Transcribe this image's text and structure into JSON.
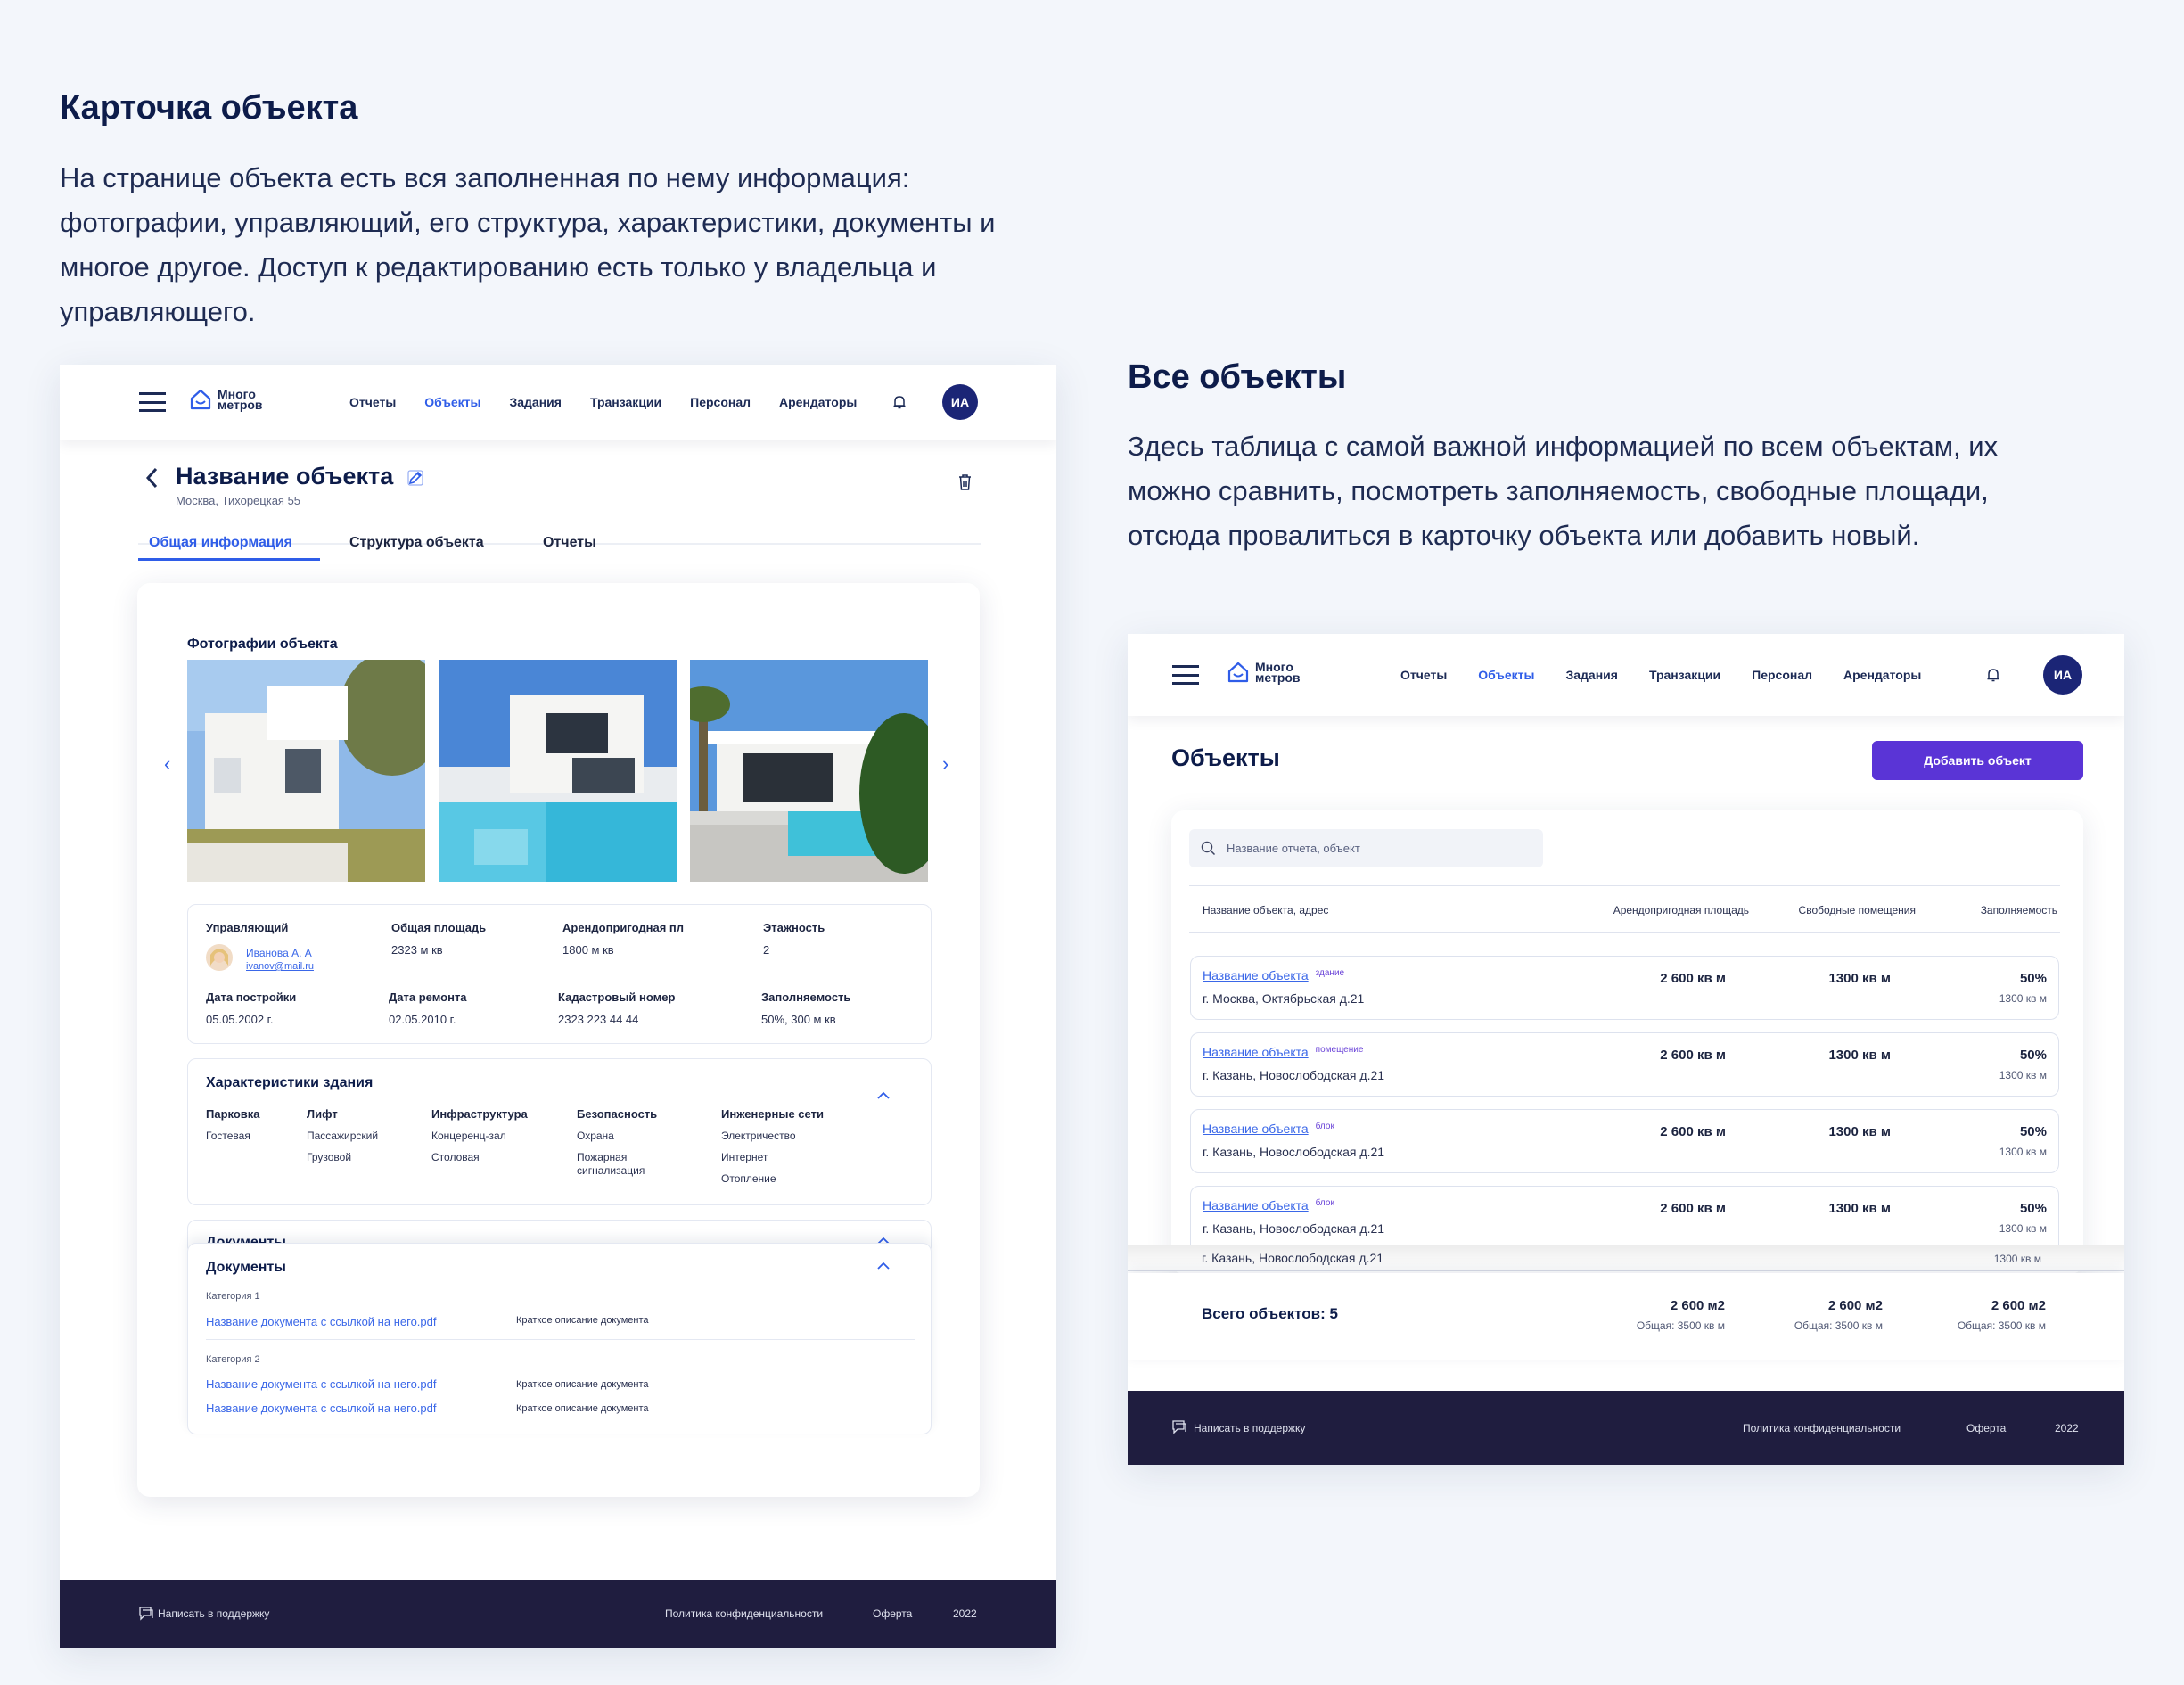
{
  "left_section": {
    "title": "Карточка объекта",
    "text": "На странице объекта есть вся заполненная по нему информация: фотографии, управляющий, его структура, характеристики, документы и многое другое. Доступ к редактированию есть только у владельца и управляющего."
  },
  "right_section": {
    "title": "Все объекты",
    "text": "Здесь таблица с самой важной информацией по всем объектам, их можно сравнить, посмотреть заполняемость, свободные площади, отсюда провалиться в карточку объекта или добавить новый."
  },
  "nav": {
    "logo_line1": "Много",
    "logo_line2": "метров",
    "items": [
      "Отчеты",
      "Объекты",
      "Задания",
      "Транзакции",
      "Персонал",
      "Арендаторы"
    ],
    "active_index": 1,
    "avatar": "ИА"
  },
  "object_card": {
    "title": "Название объекта",
    "address": "Москва, Тихорецкая 55",
    "tabs": [
      "Общая информация",
      "Структура объекта",
      "Отчеты"
    ],
    "photos_title": "Фотографии объекта",
    "info": {
      "manager_label": "Управляющий",
      "manager_name": "Иванова А. А",
      "manager_email": "ivanov@mail.ru",
      "total_area_label": "Общая площадь",
      "total_area": "2323 м кв",
      "rentable_label": "Арендопригодная пл",
      "rentable": "1800 м кв",
      "floors_label": "Этажность",
      "floors": "2",
      "built_label": "Дата постройки",
      "built": "05.05.2002 г.",
      "repair_label": "Дата ремонта",
      "repair": "02.05.2010 г.",
      "cadastral_label": "Кадастровый номер",
      "cadastral": "2323 223 44 44",
      "occupancy_label": "Заполняемость",
      "occupancy": "50%, 300 м кв"
    },
    "characteristics": {
      "title": "Характеристики здания",
      "columns": [
        {
          "head": "Парковка",
          "items": [
            "Гостевая"
          ]
        },
        {
          "head": "Лифт",
          "items": [
            "Пассажирский",
            "Грузовой"
          ]
        },
        {
          "head": "Инфраструктура",
          "items": [
            "Концеренц-зал",
            "Столовая"
          ]
        },
        {
          "head": "Безопасность",
          "items": [
            "Охрана",
            "Пожарная сигнализация"
          ]
        },
        {
          "head": "Инженерные сети",
          "items": [
            "Электричество",
            "Интернет",
            "Отопление"
          ]
        }
      ]
    },
    "documents": {
      "title_cut": "Документы",
      "title": "Документы",
      "cat1": "Категория 1",
      "cat2": "Категория 2",
      "doc_name": "Название документа с ссылкой на него.pdf",
      "doc_desc": "Краткое описание документа"
    }
  },
  "objects_page": {
    "title": "Объекты",
    "add_button": "Добавить объект",
    "search_placeholder": "Название отчета, объект",
    "headers": [
      "Название объекта, адрес",
      "Арендопригодная площадь",
      "Свободные помещения",
      "Заполняемость"
    ],
    "rows": [
      {
        "name": "Название объекта",
        "tag": "здание",
        "address": "г. Москва, Октябрьская д.21",
        "area": "2 600 кв м",
        "free": "1300 кв м",
        "occ": "50%",
        "occ_sub": "1300 кв м"
      },
      {
        "name": "Название объекта",
        "tag": "помещение",
        "address": "г. Казань, Новослободская д.21",
        "area": "2 600 кв м",
        "free": "1300 кв м",
        "occ": "50%",
        "occ_sub": "1300 кв м"
      },
      {
        "name": "Название объекта",
        "tag": "блок",
        "address": "г. Казань, Новослободская д.21",
        "area": "2 600 кв м",
        "free": "1300 кв м",
        "occ": "50%",
        "occ_sub": "1300 кв м"
      },
      {
        "name": "Название объекта",
        "tag": "блок",
        "address": "г. Казань, Новослободская д.21",
        "area": "2 600 кв м",
        "free": "1300 кв м",
        "occ": "50%",
        "occ_sub": "1300 кв м"
      }
    ],
    "cut_row_address": "г. Казань, Новослободская д.21",
    "cut_row_sub": "1300 кв м",
    "total_label": "Всего объектов: 5",
    "total_area": "2 600 м2",
    "total_area_sub": "Общая: 3500 кв м"
  },
  "footer": {
    "support": "Написать в поддержку",
    "privacy": "Политика конфиденциальности",
    "offer": "Оферта",
    "year": "2022"
  }
}
